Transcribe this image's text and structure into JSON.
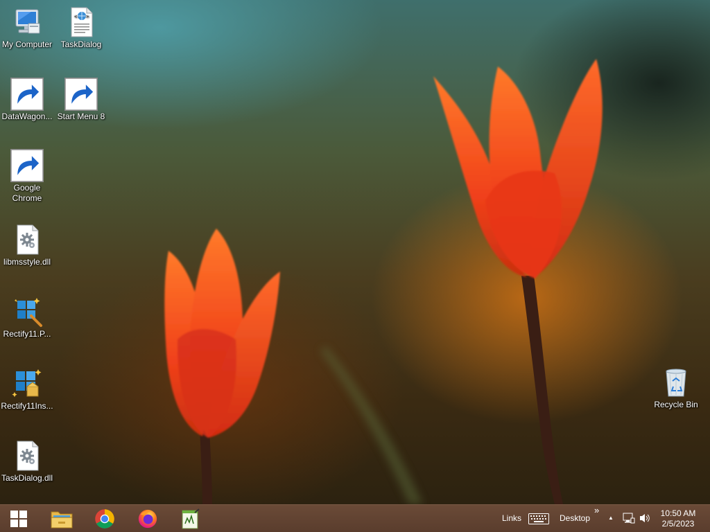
{
  "desktop": {
    "icons": [
      {
        "label": "My Computer",
        "icon": "computer-icon"
      },
      {
        "label": "TaskDialog",
        "icon": "web-document-icon"
      },
      {
        "label": "DataWagon...",
        "icon": "datawagon-icon",
        "shortcut": true
      },
      {
        "label": "Start Menu 8",
        "icon": "windows-orb-icon",
        "shortcut": true
      },
      {
        "label": "Google Chrome",
        "icon": "chrome-icon",
        "shortcut": true
      },
      {
        "label": "libmsstyle.dll",
        "icon": "dll-file-icon"
      },
      {
        "label": "Rectify11.P...",
        "icon": "rectify11-patcher-icon"
      },
      {
        "label": "Rectify11Ins...",
        "icon": "rectify11-installer-icon"
      },
      {
        "label": "TaskDialog.dll",
        "icon": "dll-file-icon"
      },
      {
        "label": "Recycle Bin",
        "icon": "recycle-bin-icon"
      }
    ]
  },
  "taskbar": {
    "start_icon": "windows-logo-icon",
    "pinned": [
      {
        "name": "file-explorer",
        "icon": "folder-icon"
      },
      {
        "name": "chrome",
        "icon": "chrome-icon"
      },
      {
        "name": "firefox",
        "icon": "firefox-icon"
      },
      {
        "name": "notepad",
        "icon": "notepad-icon"
      }
    ],
    "toolbars": {
      "links": "Links",
      "desktop": "Desktop",
      "overflow": "»"
    },
    "tray": {
      "chevron": "▲",
      "icons": [
        "keyboard-icon",
        "network-icon",
        "speaker-icon"
      ]
    },
    "clock": {
      "time": "10:50 AM",
      "date": "2/5/2023"
    }
  }
}
